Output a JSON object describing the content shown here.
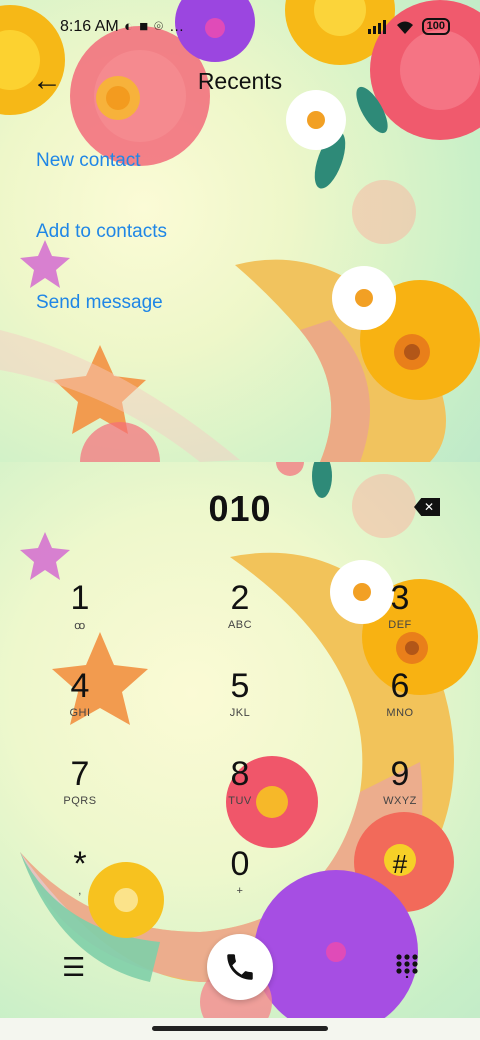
{
  "status_bar": {
    "time": "8:16 AM",
    "left_icons": [
      "vpn-icon",
      "notification-icon",
      "location-icon",
      "more-dots-icon"
    ],
    "right_icons": [
      "signal-icon",
      "wifi-icon",
      "battery-icon"
    ],
    "battery": "100"
  },
  "header": {
    "back_glyph": "←",
    "title": "Recents"
  },
  "actions": [
    {
      "label": "New contact"
    },
    {
      "label": "Add to contacts"
    },
    {
      "label": "Send message"
    }
  ],
  "dialer": {
    "number": "010",
    "backspace_icon": "backspace-icon",
    "keys": [
      {
        "digit": "1",
        "letters": "ꝏ"
      },
      {
        "digit": "2",
        "letters": "ABC"
      },
      {
        "digit": "3",
        "letters": "DEF"
      },
      {
        "digit": "4",
        "letters": "GHI"
      },
      {
        "digit": "5",
        "letters": "JKL"
      },
      {
        "digit": "6",
        "letters": "MNO"
      },
      {
        "digit": "7",
        "letters": "PQRS"
      },
      {
        "digit": "8",
        "letters": "TUV"
      },
      {
        "digit": "9",
        "letters": "WXYZ"
      },
      {
        "digit": "*",
        "letters": ","
      },
      {
        "digit": "0",
        "letters": "+"
      },
      {
        "digit": "#",
        "letters": ""
      }
    ]
  },
  "bottom_bar": {
    "menu_glyph": "☰",
    "call_icon": "phone-icon",
    "keypad_icon": "keypad-icon"
  },
  "colors": {
    "action_blue": "#1f86e6",
    "text": "#111111"
  }
}
